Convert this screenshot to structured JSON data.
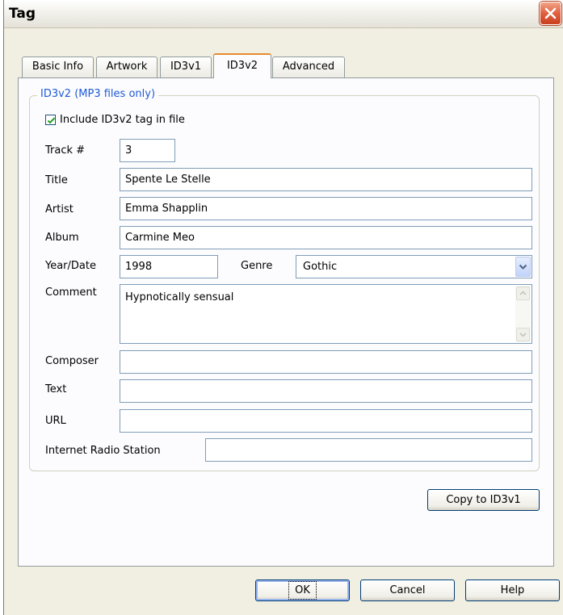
{
  "window": {
    "title": "Tag"
  },
  "tabs": [
    {
      "label": "Basic Info"
    },
    {
      "label": "Artwork"
    },
    {
      "label": "ID3v1"
    },
    {
      "label": "ID3v2",
      "active": true
    },
    {
      "label": "Advanced"
    }
  ],
  "group": {
    "legend": "ID3v2  (MP3 files only)"
  },
  "include_tag": {
    "label": "Include ID3v2 tag in file",
    "checked": true
  },
  "fields": {
    "track": {
      "label": "Track #",
      "value": "3"
    },
    "title": {
      "label": "Title",
      "value": "Spente Le Stelle"
    },
    "artist": {
      "label": "Artist",
      "value": "Emma Shapplin"
    },
    "album": {
      "label": "Album",
      "value": "Carmine Meo"
    },
    "year": {
      "label": "Year/Date",
      "value": "1998"
    },
    "genre": {
      "label": "Genre",
      "value": "Gothic"
    },
    "comment": {
      "label": "Comment",
      "value": "Hypnotically sensual"
    },
    "composer": {
      "label": "Composer",
      "value": ""
    },
    "text": {
      "label": "Text",
      "value": ""
    },
    "url": {
      "label": "URL",
      "value": ""
    },
    "radio": {
      "label": "Internet Radio Station",
      "value": ""
    }
  },
  "buttons": {
    "copy": "Copy to ID3v1",
    "ok": "OK",
    "cancel": "Cancel",
    "help": "Help"
  },
  "colors": {
    "accent": "#1d5ad6",
    "active_tab_highlight": "#e68b2c",
    "close_button": "#e0603d"
  }
}
